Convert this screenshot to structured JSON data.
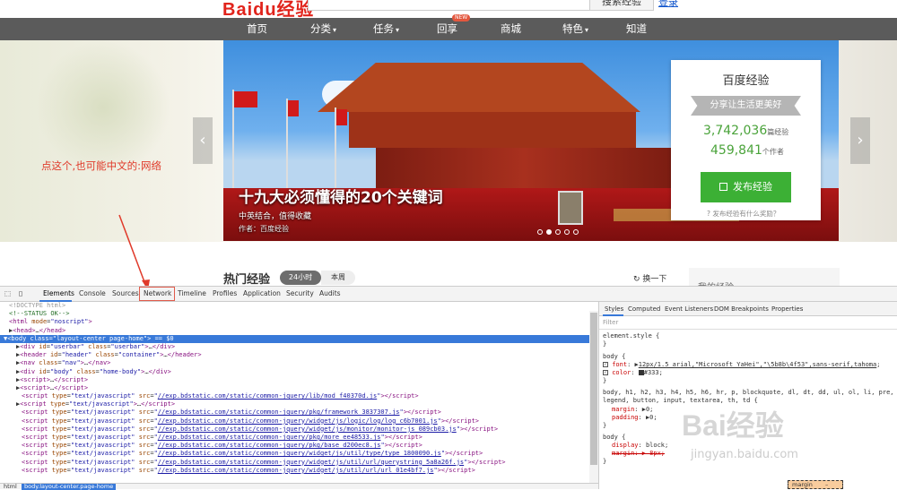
{
  "site": {
    "logo": "Baidu经验",
    "search_button": "搜索经验",
    "top_link": "登录"
  },
  "nav": {
    "items": [
      "首页",
      "分类",
      "任务",
      "回享",
      "商城",
      "特色",
      "知道"
    ],
    "new_badge": "NEW"
  },
  "banner": {
    "title": "十九大必须懂得的20个关键词",
    "subtitle": "中英结合，值得收藏",
    "author": "作者：百度经验",
    "slides_total": 5,
    "slide_active": 2
  },
  "card": {
    "title": "百度经验",
    "ribbon": "分享让生活更美好",
    "experiences_count": "3,742,036",
    "experiences_unit": "篇经验",
    "authors_count": "459,841",
    "authors_unit": "个作者",
    "publish_button": "发布经验",
    "help": "发布经验有什么奖励？"
  },
  "annotation": "点这个,也可能中文的:网络",
  "hot": {
    "title": "热门经验",
    "tab_24h": "24小时",
    "tab_week": "本周",
    "refresh": "换一下",
    "my_experience": "我的经验"
  },
  "devtools": {
    "tabs": [
      "Elements",
      "Console",
      "Sources",
      "Network",
      "Timeline",
      "Profiles",
      "Application",
      "Security",
      "Audits"
    ],
    "active_tab": "Elements",
    "highlighted_tab": "Network",
    "breadcrumb": [
      "html",
      "body.layout-center.page-home"
    ],
    "styles_tabs": [
      "Styles",
      "Computed",
      "Event Listeners",
      "DOM Breakpoints",
      "Properties"
    ],
    "filter_placeholder": "Filter",
    "margin_label": "margin",
    "margin_value": "–"
  },
  "colors": {
    "brand_red": "#e1241c",
    "green": "#3cb035",
    "nav_bg": "#5b5b5b",
    "selection": "#3879d9"
  },
  "watermark": {
    "text": "Bai经验",
    "url": "jingyan.baidu.com"
  }
}
